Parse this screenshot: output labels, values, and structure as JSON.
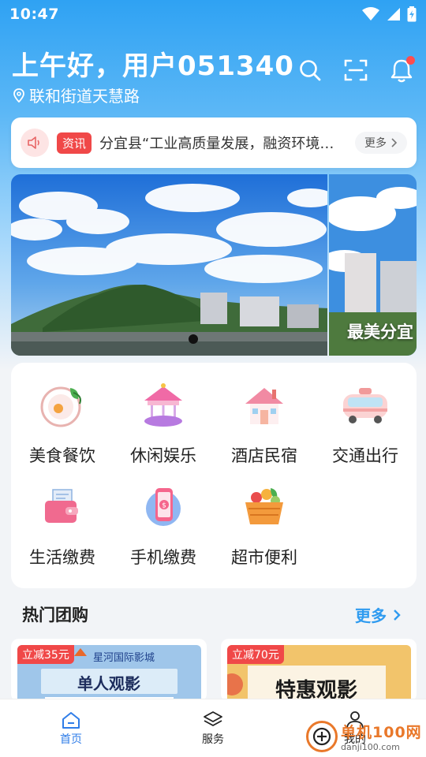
{
  "status_bar": {
    "time": "10:47"
  },
  "header": {
    "greeting": "上午好，用户051340",
    "location": "联和街道天慧路",
    "icons": [
      "search-icon",
      "scan-icon",
      "bell-icon"
    ]
  },
  "news": {
    "tag": "资讯",
    "text": "分宜县“工业高质量发展，融资环境…",
    "more_label": "更多"
  },
  "banner": {
    "caption": "最美分宜"
  },
  "services": [
    {
      "label": "美食餐饮",
      "icon": "food-plate-icon"
    },
    {
      "label": "休闲娱乐",
      "icon": "carousel-icon"
    },
    {
      "label": "酒店民宿",
      "icon": "house-icon"
    },
    {
      "label": "交通出行",
      "icon": "bus-icon"
    },
    {
      "label": "生活缴费",
      "icon": "wallet-icon"
    },
    {
      "label": "手机缴费",
      "icon": "phone-payment-icon"
    },
    {
      "label": "超市便利",
      "icon": "shopping-basket-icon"
    }
  ],
  "hot_deals": {
    "title": "热门团购",
    "more_label": "更多",
    "items": [
      {
        "badge": "立减35元",
        "cinema": "星河国际影城",
        "headline": "单人观影"
      },
      {
        "badge": "立减70元",
        "headline": "特惠观影"
      }
    ]
  },
  "tabbar": [
    {
      "label": "首页",
      "icon": "home-icon",
      "active": true
    },
    {
      "label": "服务",
      "icon": "layers-icon",
      "active": false
    },
    {
      "label": "我的",
      "icon": "user-icon",
      "active": false
    }
  ],
  "watermark": {
    "main": "单机100网",
    "sub": "danji100.com"
  },
  "colors": {
    "accent": "#2f9bf0",
    "badge_red": "#f04848",
    "tab_active": "#2f7de8"
  }
}
